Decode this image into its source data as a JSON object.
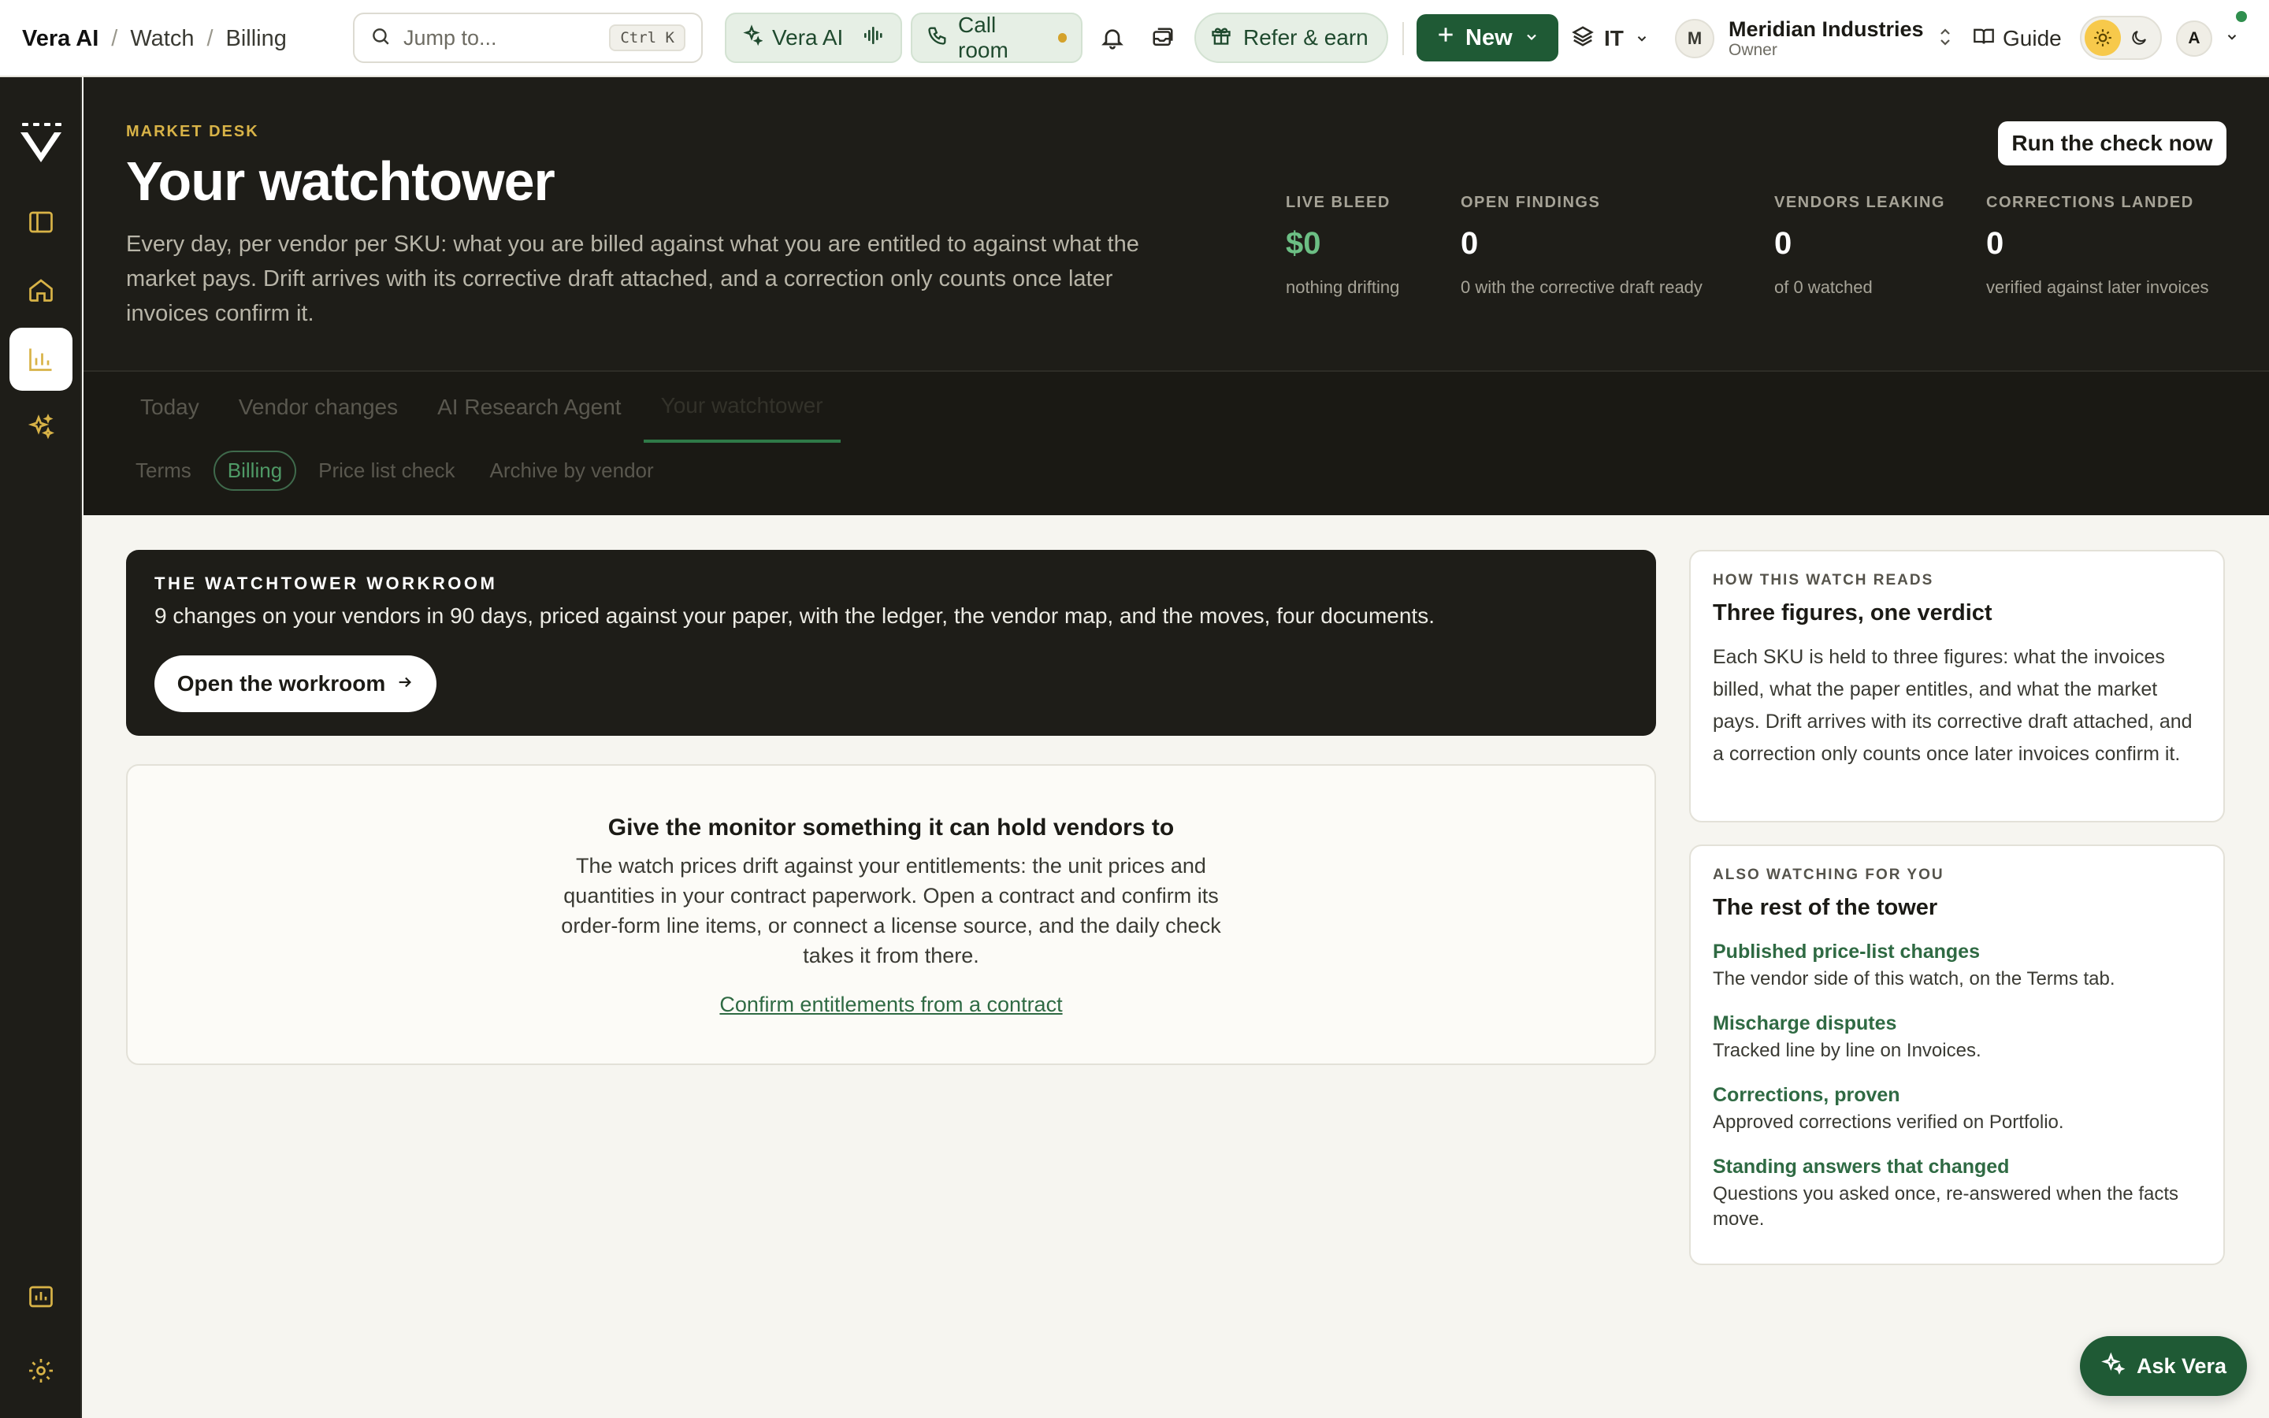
{
  "topbar": {
    "breadcrumb": {
      "app": "Vera AI",
      "section": "Watch",
      "page": "Billing"
    },
    "search": {
      "placeholder": "Jump to...",
      "shortcut": "Ctrl K"
    },
    "vera_label": "Vera AI",
    "call_room_label": "Call room",
    "refer_label": "Refer & earn",
    "new_label": "New",
    "workspace_label": "IT",
    "org": {
      "initial": "M",
      "name": "Meridian Industries",
      "role": "Owner"
    },
    "guide_label": "Guide",
    "account_initial": "A"
  },
  "hero": {
    "eyebrow": "MARKET DESK",
    "title": "Your watchtower",
    "lede": "Every day, per vendor per SKU: what you are billed against what you are entitled to against what the market pays. Drift arrives with its corrective draft attached, and a correction only counts once later invoices confirm it.",
    "run_button": "Run the check now",
    "stats": [
      {
        "label": "LIVE BLEED",
        "value": "$0",
        "sub": "nothing drifting"
      },
      {
        "label": "OPEN FINDINGS",
        "value": "0",
        "sub": "0 with the corrective draft ready"
      },
      {
        "label": "VENDORS LEAKING",
        "value": "0",
        "sub": "of 0 watched"
      },
      {
        "label": "CORRECTIONS LANDED",
        "value": "0",
        "sub": "verified against later invoices"
      }
    ]
  },
  "tabs": [
    "Today",
    "Vendor changes",
    "AI Research Agent",
    "Your watchtower"
  ],
  "subtabs": [
    "Terms",
    "Billing",
    "Price list check",
    "Archive by vendor"
  ],
  "workroom": {
    "eyebrow": "THE WATCHTOWER WORKROOM",
    "description": "9 changes on your vendors in 90 days, priced against your paper, with the ledger, the vendor map, and the moves, four documents.",
    "button": "Open the workroom"
  },
  "empty_state": {
    "title": "Give the monitor something it can hold vendors to",
    "body": "The watch prices drift against your entitlements: the unit prices and quantities in your contract paperwork. Open a contract and confirm its order-form line items, or connect a license source, and the daily check takes it from there.",
    "link": "Confirm entitlements from a contract"
  },
  "how_card": {
    "eyebrow": "HOW THIS WATCH READS",
    "title": "Three figures, one verdict",
    "body": "Each SKU is held to three figures: what the invoices billed, what the paper entitles, and what the market pays. Drift arrives with its corrective draft attached, and a correction only counts once later invoices confirm it."
  },
  "also_card": {
    "eyebrow": "ALSO WATCHING FOR YOU",
    "title": "The rest of the tower",
    "items": [
      {
        "label": "Published price-list changes",
        "desc": "The vendor side of this watch, on the Terms tab."
      },
      {
        "label": "Mischarge disputes",
        "desc": "Tracked line by line on Invoices."
      },
      {
        "label": "Corrections, proven",
        "desc": "Approved corrections verified on Portfolio."
      },
      {
        "label": "Standing answers that changed",
        "desc": "Questions you asked once, re-answered when the facts move."
      }
    ]
  },
  "ask_label": "Ask Vera",
  "colors": {
    "brand_green": "#1f5a35",
    "accent_gold": "#d8b347",
    "dark_bg": "#1e1d18",
    "link_green": "#2f6a43"
  }
}
